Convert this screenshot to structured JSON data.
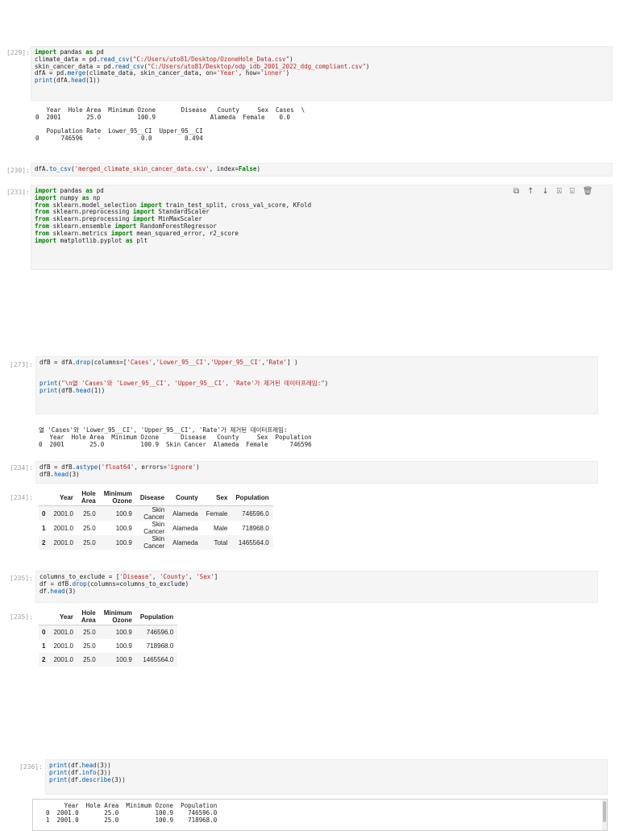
{
  "cell229": {
    "prompt": "[229]:",
    "lines": [
      [
        [
          "kw",
          "import"
        ],
        [
          "t",
          " pandas "
        ],
        [
          "kw",
          "as"
        ],
        [
          "t",
          " pd"
        ]
      ],
      [
        [
          "t",
          "climate_data = pd."
        ],
        [
          "fn",
          "read_csv"
        ],
        [
          "t",
          "("
        ],
        [
          "str",
          "\"C:/Users/uto81/Desktop/OzoneHole_Data.csv\""
        ],
        [
          "t",
          ")"
        ]
      ],
      [
        [
          "t",
          "skin_cancer_data = pd."
        ],
        [
          "fn",
          "read_csv"
        ],
        [
          "t",
          "("
        ],
        [
          "str",
          "\"C:/Users/uto81/Desktop/odp_idb_2001_2022_ddg_compliant.csv\""
        ],
        [
          "t",
          ")"
        ]
      ],
      [
        [
          "t",
          "dfA = pd."
        ],
        [
          "fn",
          "merge"
        ],
        [
          "t",
          "(climate_data, skin_cancer_data, on="
        ],
        [
          "str",
          "'Year'"
        ],
        [
          "t",
          ", how="
        ],
        [
          "str",
          "'inner'"
        ],
        [
          "t",
          ")"
        ]
      ],
      [
        [
          "fn",
          "print"
        ],
        [
          "t",
          "(dfA."
        ],
        [
          "fn",
          "head"
        ],
        [
          "t",
          "(1))"
        ]
      ]
    ],
    "output": [
      "   Year  Hole Area  Minimum Ozone       Disease   County     Sex  Cases  \\",
      "0  2001       25.0          100.9               Alameda  Female    0.0",
      "",
      "   Population Rate  Lower_95__CI  Upper_95__CI",
      "0      746596    -           0.0         0.494"
    ]
  },
  "cell230": {
    "prompt": "[230]:",
    "lines": [
      [
        [
          "t",
          "dfA."
        ],
        [
          "fn",
          "to_csv"
        ],
        [
          "t",
          "("
        ],
        [
          "str",
          "'merged_climate_skin_cancer_data.csv'"
        ],
        [
          "t",
          ", index="
        ],
        [
          "kw",
          "False"
        ],
        [
          "t",
          ")"
        ]
      ]
    ]
  },
  "cell231": {
    "prompt": "[231]:",
    "lines": [
      [
        [
          "kw",
          "import"
        ],
        [
          "t",
          " pandas "
        ],
        [
          "kw",
          "as"
        ],
        [
          "t",
          " pd"
        ]
      ],
      [
        [
          "kw",
          "import"
        ],
        [
          "t",
          " numpy "
        ],
        [
          "kw",
          "as"
        ],
        [
          "t",
          " np"
        ]
      ],
      [
        [
          "kw",
          "from"
        ],
        [
          "t",
          " sklearn.model_selection "
        ],
        [
          "kw",
          "import"
        ],
        [
          "t",
          " train_test_split, cross_val_score, KFold"
        ]
      ],
      [
        [
          "kw",
          "from"
        ],
        [
          "t",
          " sklearn.preprocessing "
        ],
        [
          "kw",
          "import"
        ],
        [
          "t",
          " StandardScaler"
        ]
      ],
      [
        [
          "kw",
          "from"
        ],
        [
          "t",
          " sklearn.preprocessing "
        ],
        [
          "kw",
          "import"
        ],
        [
          "t",
          " MinMaxScaler"
        ]
      ],
      [
        [
          "kw",
          "from"
        ],
        [
          "t",
          " sklearn.ensemble "
        ],
        [
          "kw",
          "import"
        ],
        [
          "t",
          " RandomForestRegressor"
        ]
      ],
      [
        [
          "kw",
          "from"
        ],
        [
          "t",
          " sklearn.metrics "
        ],
        [
          "kw",
          "import"
        ],
        [
          "t",
          " mean_squared_error, r2_score"
        ]
      ],
      [
        [
          "kw",
          "import"
        ],
        [
          "t",
          " matplotlib.pyplot "
        ],
        [
          "kw",
          "as"
        ],
        [
          "t",
          " plt"
        ]
      ]
    ],
    "toolbar": {
      "copy": "⧉",
      "up": "↑",
      "down": "↓",
      "insert_above": "⍓",
      "insert_below": "⍌",
      "delete": "🗑"
    }
  },
  "cell273": {
    "prompt": "[273]:",
    "lines": [
      [
        [
          "t",
          "dfB = dfA."
        ],
        [
          "fn",
          "drop"
        ],
        [
          "t",
          "(columns=["
        ],
        [
          "str",
          "'Cases'"
        ],
        [
          "t",
          ","
        ],
        [
          "str",
          "'Lower_95__CI'"
        ],
        [
          "t",
          ","
        ],
        [
          "str",
          "'Upper_95__CI'"
        ],
        [
          "t",
          ","
        ],
        [
          "str",
          "'Rate'"
        ],
        [
          "t",
          "] )"
        ]
      ],
      [
        [
          "t",
          ""
        ]
      ],
      [
        [
          "t",
          ""
        ]
      ],
      [
        [
          "fn",
          "print"
        ],
        [
          "t",
          "("
        ],
        [
          "str",
          "\"\\n열 'Cases'와 'Lower_95__CI', 'Upper_95__CI', 'Rate'가 제거된 데이터프레임:\""
        ],
        [
          "t",
          ")"
        ]
      ],
      [
        [
          "fn",
          "print"
        ],
        [
          "t",
          "(dfB."
        ],
        [
          "fn",
          "head"
        ],
        [
          "t",
          "(1))"
        ]
      ]
    ],
    "output": [
      "열 'Cases'와 'Lower_95__CI', 'Upper_95__CI', 'Rate'가 제거된 데이터프레임:",
      "   Year  Hole Area  Minimum Ozone      Disease   County     Sex  Population",
      "0  2001       25.0          100.9  Skin Cancer  Alameda  Female      746596"
    ]
  },
  "cell234": {
    "prompt": "[234]:",
    "lines": [
      [
        [
          "t",
          "dfB = dfB."
        ],
        [
          "fn",
          "astype"
        ],
        [
          "t",
          "("
        ],
        [
          "str",
          "'float64'"
        ],
        [
          "t",
          ", errors="
        ],
        [
          "str",
          "'ignore'"
        ],
        [
          "t",
          ")"
        ]
      ],
      [
        [
          "t",
          "dfB."
        ],
        [
          "fn",
          "head"
        ],
        [
          "t",
          "(3)"
        ]
      ]
    ],
    "out_prompt": "[234]:",
    "table": {
      "headers": [
        "",
        "Year",
        "Hole Area",
        "Minimum Ozone",
        "Disease",
        "County",
        "Sex",
        "Population"
      ],
      "rows": [
        [
          "0",
          "2001.0",
          "25.0",
          "100.9",
          "Skin Cancer",
          "Alameda",
          "Female",
          "746596.0"
        ],
        [
          "1",
          "2001.0",
          "25.0",
          "100.9",
          "Skin Cancer",
          "Alameda",
          "Male",
          "718968.0"
        ],
        [
          "2",
          "2001.0",
          "25.0",
          "100.9",
          "Skin Cancer",
          "Alameda",
          "Total",
          "1465564.0"
        ]
      ]
    }
  },
  "cell235": {
    "prompt": "[235]:",
    "lines": [
      [
        [
          "t",
          "columns_to_exclude = ["
        ],
        [
          "str",
          "'Disease'"
        ],
        [
          "t",
          ", "
        ],
        [
          "str",
          "'County'"
        ],
        [
          "t",
          ", "
        ],
        [
          "str",
          "'Sex'"
        ],
        [
          "t",
          "]"
        ]
      ],
      [
        [
          "t",
          "df = dfB."
        ],
        [
          "fn",
          "drop"
        ],
        [
          "t",
          "(columns=columns_to_exclude)"
        ]
      ],
      [
        [
          "t",
          "df."
        ],
        [
          "fn",
          "head"
        ],
        [
          "t",
          "(3)"
        ]
      ]
    ],
    "out_prompt": "[235]:",
    "table": {
      "headers": [
        "",
        "Year",
        "Hole Area",
        "Minimum Ozone",
        "Population"
      ],
      "rows": [
        [
          "0",
          "2001.0",
          "25.0",
          "100.9",
          "746596.0"
        ],
        [
          "1",
          "2001.0",
          "25.0",
          "100.9",
          "718968.0"
        ],
        [
          "2",
          "2001.0",
          "25.0",
          "100.9",
          "1465564.0"
        ]
      ]
    }
  },
  "cell236": {
    "prompt": "[236]:",
    "lines": [
      [
        [
          "fn",
          "print"
        ],
        [
          "t",
          "(df."
        ],
        [
          "fn",
          "head"
        ],
        [
          "t",
          "(3))"
        ]
      ],
      [
        [
          "fn",
          "print"
        ],
        [
          "t",
          "(df."
        ],
        [
          "fn",
          "info"
        ],
        [
          "t",
          "(3))"
        ]
      ],
      [
        [
          "fn",
          "print"
        ],
        [
          "t",
          "(df."
        ],
        [
          "fn",
          "describe"
        ],
        [
          "t",
          "(3))"
        ]
      ]
    ],
    "output": [
      "     Year  Hole Area  Minimum Ozone  Population",
      "0  2001.0       25.0          100.9    746596.0",
      "1  2001.0       25.0          100.9    718968.0"
    ]
  }
}
